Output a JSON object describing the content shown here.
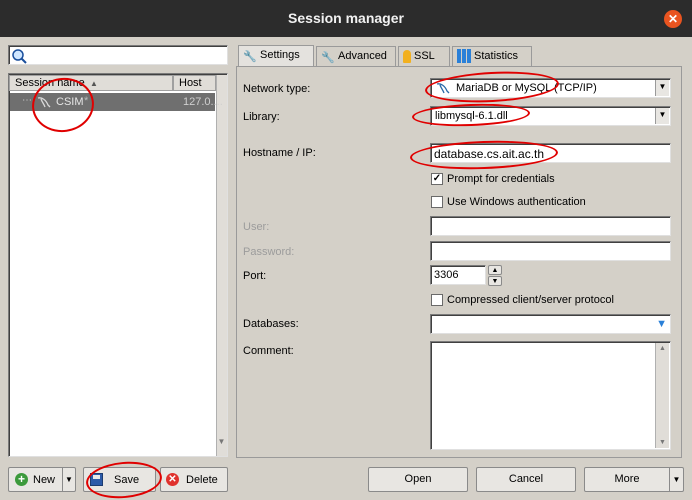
{
  "window": {
    "title": "Session manager"
  },
  "left_panel": {
    "search_placeholder": "",
    "columns": [
      "Session name",
      "Host"
    ],
    "sessions": [
      {
        "name": "CSIM",
        "host": "127.0...."
      }
    ],
    "buttons": {
      "new": "New",
      "save": "Save",
      "delete": "Delete"
    }
  },
  "tabs": [
    {
      "label": "Settings",
      "active": true
    },
    {
      "label": "Advanced",
      "active": false
    },
    {
      "label": "SSL",
      "active": false
    },
    {
      "label": "Statistics",
      "active": false
    }
  ],
  "settings": {
    "network_type": {
      "label": "Network type:",
      "value": "MariaDB or MySQL (TCP/IP)"
    },
    "library": {
      "label": "Library:",
      "value": "libmysql-6.1.dll"
    },
    "hostname": {
      "label": "Hostname / IP:",
      "value": "database.cs.ait.ac.th"
    },
    "prompt_credentials": {
      "label": "Prompt for credentials",
      "checked": true
    },
    "windows_auth": {
      "label": "Use Windows authentication",
      "checked": false
    },
    "user": {
      "label": "User:",
      "value": ""
    },
    "password": {
      "label": "Password:",
      "value": ""
    },
    "port": {
      "label": "Port:",
      "value": "3306"
    },
    "compressed": {
      "label": "Compressed client/server protocol",
      "checked": false
    },
    "databases": {
      "label": "Databases:",
      "value": ""
    },
    "comment": {
      "label": "Comment:",
      "value": ""
    }
  },
  "bottom_buttons": {
    "open": "Open",
    "cancel": "Cancel",
    "more": "More"
  },
  "colors": {
    "titlebar": "#2c2c2c",
    "close": "#e95420",
    "annotation": "#e00000",
    "selection": "#6f6f6f"
  }
}
